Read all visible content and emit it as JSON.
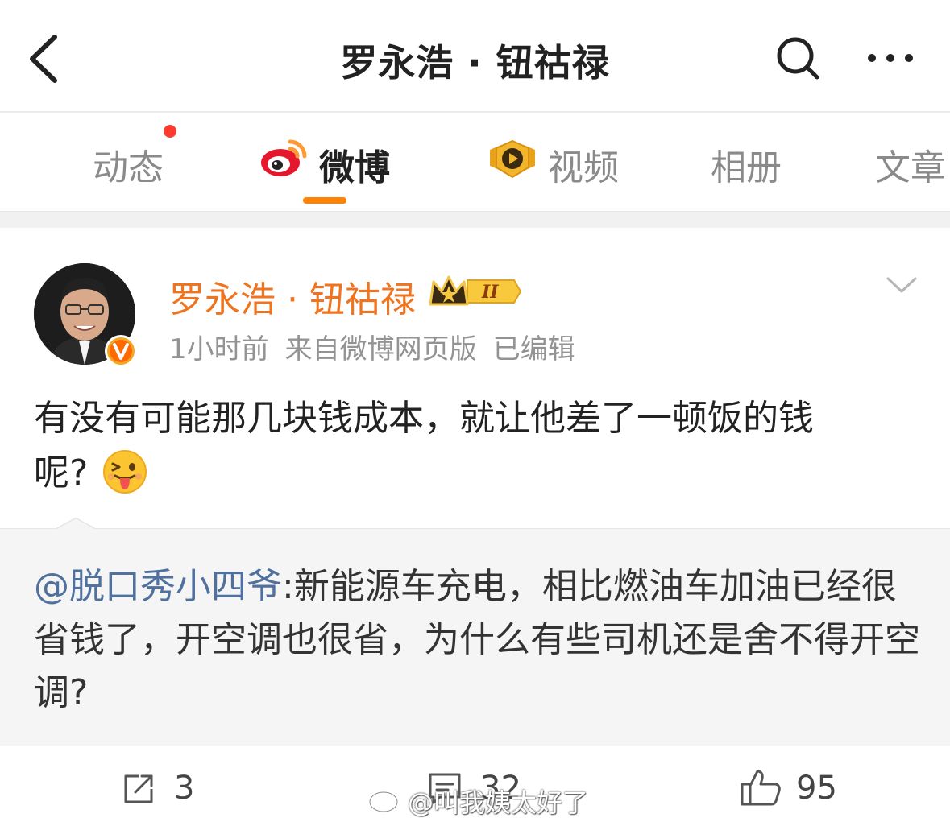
{
  "header": {
    "title": "罗永浩 · 钮祜禄",
    "back_icon": "chevron-left-icon",
    "search_icon": "search-icon",
    "more_icon": "more-icon"
  },
  "tabs": [
    {
      "label": "动态",
      "has_dot": true
    },
    {
      "label": "微博",
      "active": true,
      "icon": "weibo-logo-icon"
    },
    {
      "label": "视频",
      "icon": "video-shield-icon"
    },
    {
      "label": "相册"
    },
    {
      "label": "文章"
    }
  ],
  "colors": {
    "accent": "#ff8200",
    "author": "#f0731e",
    "mention": "#50709e",
    "notification_dot": "#ff3b30"
  },
  "post": {
    "author": "罗永浩 · 钮祜禄",
    "time": "1小时前",
    "source": "来自微博网页版",
    "edited": "已编辑",
    "text_line1": "有没有可能那几块钱成本，就让他差了一顿饭的钱",
    "text_line2": "呢?",
    "emoji": "tongue-emoji"
  },
  "quote": {
    "mention": "@脱口秀小四爷",
    "text": ":新能源车充电，相比燃油车加油已经很省钱了，开空调也很省，为什么有些司机还是舍不得开空调?"
  },
  "actions": {
    "shares": "3",
    "comments": "32",
    "likes": "95"
  },
  "watermark": "@叫我姨太好了"
}
